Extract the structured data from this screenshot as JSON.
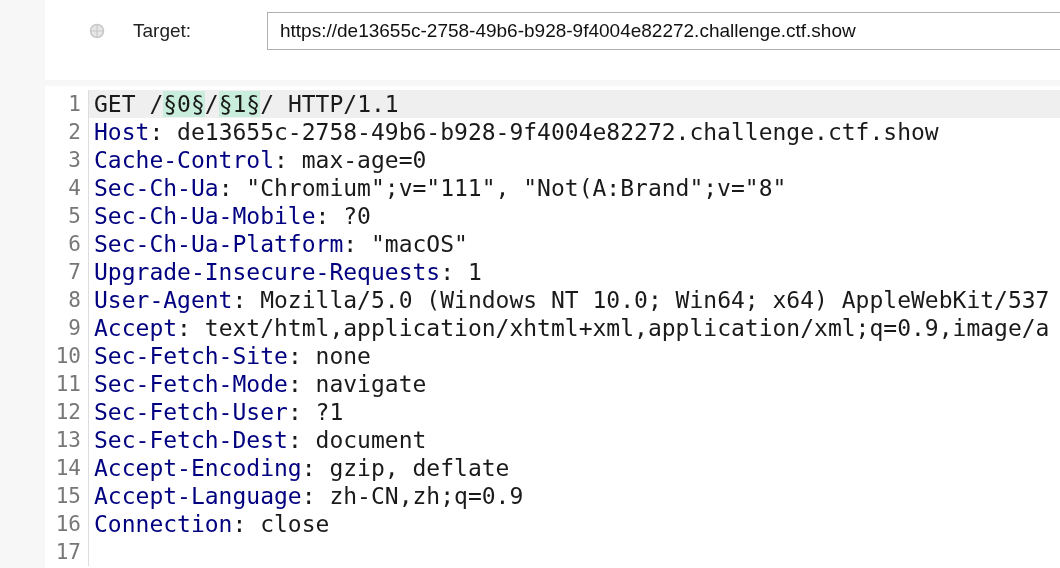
{
  "target": {
    "label": "Target:",
    "value": "https://de13655c-2758-49b6-b928-9f4004e82272.challenge.ctf.show"
  },
  "editor": {
    "lines": [
      {
        "number": "1",
        "current": true,
        "segments": [
          {
            "kind": "plain",
            "text": "GET /"
          },
          {
            "kind": "marker",
            "text": "§0§"
          },
          {
            "kind": "plain",
            "text": "/"
          },
          {
            "kind": "marker",
            "text": "§1§"
          },
          {
            "kind": "plain",
            "text": "/ HTTP/1.1"
          }
        ]
      },
      {
        "number": "2",
        "current": false,
        "segments": [
          {
            "kind": "key",
            "text": "Host"
          },
          {
            "kind": "plain",
            "text": ": de13655c-2758-49b6-b928-9f4004e82272.challenge.ctf.show"
          }
        ]
      },
      {
        "number": "3",
        "current": false,
        "segments": [
          {
            "kind": "key",
            "text": "Cache-Control"
          },
          {
            "kind": "plain",
            "text": ": max-age=0"
          }
        ]
      },
      {
        "number": "4",
        "current": false,
        "segments": [
          {
            "kind": "key",
            "text": "Sec-Ch-Ua"
          },
          {
            "kind": "plain",
            "text": ": \"Chromium\";v=\"111\", \"Not(A:Brand\";v=\"8\""
          }
        ]
      },
      {
        "number": "5",
        "current": false,
        "segments": [
          {
            "kind": "key",
            "text": "Sec-Ch-Ua-Mobile"
          },
          {
            "kind": "plain",
            "text": ": ?0"
          }
        ]
      },
      {
        "number": "6",
        "current": false,
        "segments": [
          {
            "kind": "key",
            "text": "Sec-Ch-Ua-Platform"
          },
          {
            "kind": "plain",
            "text": ": \"macOS\""
          }
        ]
      },
      {
        "number": "7",
        "current": false,
        "segments": [
          {
            "kind": "key",
            "text": "Upgrade-Insecure-Requests"
          },
          {
            "kind": "plain",
            "text": ": 1"
          }
        ]
      },
      {
        "number": "8",
        "current": false,
        "segments": [
          {
            "kind": "key",
            "text": "User-Agent"
          },
          {
            "kind": "plain",
            "text": ": Mozilla/5.0 (Windows NT 10.0; Win64; x64) AppleWebKit/537"
          }
        ]
      },
      {
        "number": "9",
        "current": false,
        "segments": [
          {
            "kind": "key",
            "text": "Accept"
          },
          {
            "kind": "plain",
            "text": ": text/html,application/xhtml+xml,application/xml;q=0.9,image/a"
          }
        ]
      },
      {
        "number": "10",
        "current": false,
        "segments": [
          {
            "kind": "key",
            "text": "Sec-Fetch-Site"
          },
          {
            "kind": "plain",
            "text": ": none"
          }
        ]
      },
      {
        "number": "11",
        "current": false,
        "segments": [
          {
            "kind": "key",
            "text": "Sec-Fetch-Mode"
          },
          {
            "kind": "plain",
            "text": ": navigate"
          }
        ]
      },
      {
        "number": "12",
        "current": false,
        "segments": [
          {
            "kind": "key",
            "text": "Sec-Fetch-User"
          },
          {
            "kind": "plain",
            "text": ": ?1"
          }
        ]
      },
      {
        "number": "13",
        "current": false,
        "segments": [
          {
            "kind": "key",
            "text": "Sec-Fetch-Dest"
          },
          {
            "kind": "plain",
            "text": ": document"
          }
        ]
      },
      {
        "number": "14",
        "current": false,
        "segments": [
          {
            "kind": "key",
            "text": "Accept-Encoding"
          },
          {
            "kind": "plain",
            "text": ": gzip, deflate"
          }
        ]
      },
      {
        "number": "15",
        "current": false,
        "segments": [
          {
            "kind": "key",
            "text": "Accept-Language"
          },
          {
            "kind": "plain",
            "text": ": zh-CN,zh;q=0.9"
          }
        ]
      },
      {
        "number": "16",
        "current": false,
        "segments": [
          {
            "kind": "key",
            "text": "Connection"
          },
          {
            "kind": "plain",
            "text": ": close"
          }
        ]
      },
      {
        "number": "17",
        "current": false
      }
    ]
  }
}
